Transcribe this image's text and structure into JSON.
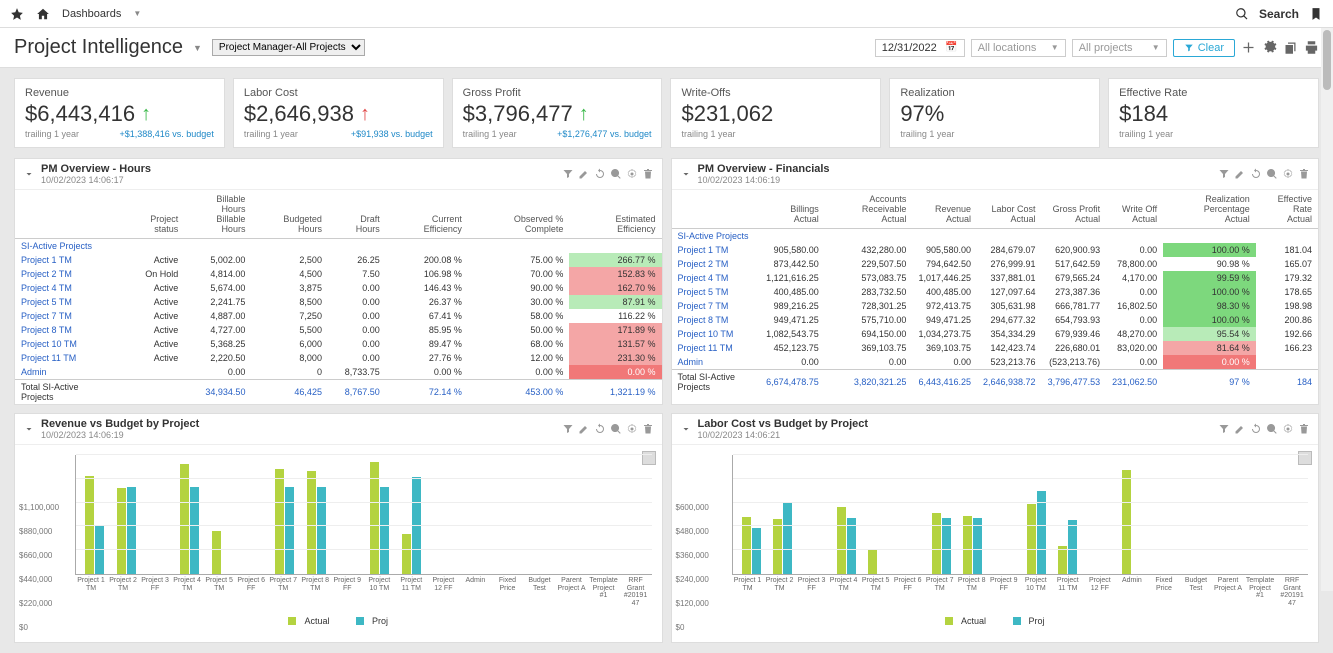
{
  "topbar": {
    "dashboards": "Dashboards",
    "search": "Search"
  },
  "header": {
    "title": "Project Intelligence",
    "dropdown": "Project Manager-All Projects",
    "date": "12/31/2022",
    "loc": "All locations",
    "proj": "All projects",
    "clear": "Clear"
  },
  "kpis": [
    {
      "label": "Revenue",
      "value": "$6,443,416",
      "arrow": "up",
      "sub": "trailing 1 year",
      "budget": "+$1,388,416 vs. budget"
    },
    {
      "label": "Labor Cost",
      "value": "$2,646,938",
      "arrow": "down-red",
      "sub": "trailing 1 year",
      "budget": "+$91,938 vs. budget"
    },
    {
      "label": "Gross Profit",
      "value": "$3,796,477",
      "arrow": "up",
      "sub": "trailing 1 year",
      "budget": "+$1,276,477 vs. budget"
    },
    {
      "label": "Write-Offs",
      "value": "$231,062",
      "arrow": "",
      "sub": "trailing 1 year",
      "budget": ""
    },
    {
      "label": "Realization",
      "value": "97%",
      "arrow": "",
      "sub": "trailing 1 year",
      "budget": ""
    },
    {
      "label": "Effective Rate",
      "value": "$184",
      "arrow": "",
      "sub": "trailing 1 year",
      "budget": ""
    }
  ],
  "hours": {
    "title": "PM Overview - Hours",
    "ts": "10/02/2023 14:06:17",
    "group": "SI-Active Projects",
    "cols": [
      "",
      "Project status",
      "Billable Hours\nBillable Hours",
      "Budgeted Hours",
      "Draft Hours",
      "Current Efficiency",
      "Observed % Complete",
      "Estimated Efficiency"
    ],
    "rows": [
      [
        "Project 1 TM",
        "Active",
        "5,002.00",
        "2,500",
        "26.25",
        "200.08 %",
        "75.00 %",
        "266.77 %",
        "lgreen"
      ],
      [
        "Project 2 TM",
        "On Hold",
        "4,814.00",
        "4,500",
        "7.50",
        "106.98 %",
        "70.00 %",
        "152.83 %",
        "red"
      ],
      [
        "Project 4 TM",
        "Active",
        "5,674.00",
        "3,875",
        "0.00",
        "146.43 %",
        "90.00 %",
        "162.70 %",
        "red"
      ],
      [
        "Project 5 TM",
        "Active",
        "2,241.75",
        "8,500",
        "0.00",
        "26.37 %",
        "30.00 %",
        "87.91 %",
        "lgreen"
      ],
      [
        "Project 7 TM",
        "Active",
        "4,887.00",
        "7,250",
        "0.00",
        "67.41 %",
        "58.00 %",
        "116.22 %",
        ""
      ],
      [
        "Project 8 TM",
        "Active",
        "4,727.00",
        "5,500",
        "0.00",
        "85.95 %",
        "50.00 %",
        "171.89 %",
        "red"
      ],
      [
        "Project 10 TM",
        "Active",
        "5,368.25",
        "6,000",
        "0.00",
        "89.47 %",
        "68.00 %",
        "131.57 %",
        "red"
      ],
      [
        "Project 11 TM",
        "Active",
        "2,220.50",
        "8,000",
        "0.00",
        "27.76 %",
        "12.00 %",
        "231.30 %",
        "red"
      ],
      [
        "Admin",
        "",
        "0.00",
        "0",
        "8,733.75",
        "0.00 %",
        "0.00 %",
        "0.00 %",
        "dred"
      ]
    ],
    "total": [
      "Total SI-Active Projects",
      "",
      "34,934.50",
      "46,425",
      "8,767.50",
      "72.14 %",
      "453.00 %",
      "1,321.19 %"
    ]
  },
  "fin": {
    "title": "PM Overview - Financials",
    "ts": "10/02/2023 14:06:19",
    "group": "SI-Active Projects",
    "cols": [
      "",
      "Billings\nActual",
      "Accounts Receivable\nActual",
      "Revenue\nActual",
      "Labor Cost\nActual",
      "Gross Profit\nActual",
      "Write Off\nActual",
      "Realization Percentage\nActual",
      "Effective Rate\nActual"
    ],
    "rows": [
      [
        "Project 1 TM",
        "905,580.00",
        "432,280.00",
        "905,580.00",
        "284,679.07",
        "620,900.93",
        "0.00",
        "100.00 %",
        "181.04",
        "green"
      ],
      [
        "Project 2 TM",
        "873,442.50",
        "229,507.50",
        "794,642.50",
        "276,999.91",
        "517,642.59",
        "78,800.00",
        "90.98 %",
        "165.07",
        ""
      ],
      [
        "Project 4 TM",
        "1,121,616.25",
        "573,083.75",
        "1,017,446.25",
        "337,881.01",
        "679,565.24",
        "4,170.00",
        "99.59 %",
        "179.32",
        "green"
      ],
      [
        "Project 5 TM",
        "400,485.00",
        "283,732.50",
        "400,485.00",
        "127,097.64",
        "273,387.36",
        "0.00",
        "100.00 %",
        "178.65",
        "green"
      ],
      [
        "Project 7 TM",
        "989,216.25",
        "728,301.25",
        "972,413.75",
        "305,631.98",
        "666,781.77",
        "16,802.50",
        "98.30 %",
        "198.98",
        "green"
      ],
      [
        "Project 8 TM",
        "949,471.25",
        "575,710.00",
        "949,471.25",
        "294,677.32",
        "654,793.93",
        "0.00",
        "100.00 %",
        "200.86",
        "green"
      ],
      [
        "Project 10 TM",
        "1,082,543.75",
        "694,150.00",
        "1,034,273.75",
        "354,334.29",
        "679,939.46",
        "48,270.00",
        "95.54 %",
        "192.66",
        "lgreen"
      ],
      [
        "Project 11 TM",
        "452,123.75",
        "369,103.75",
        "369,103.75",
        "142,423.74",
        "226,680.01",
        "83,020.00",
        "81.64 %",
        "166.23",
        "red"
      ],
      [
        "Admin",
        "0.00",
        "0.00",
        "0.00",
        "523,213.76",
        "(523,213.76)",
        "0.00",
        "0.00 %",
        "",
        "dred"
      ]
    ],
    "total": [
      "Total SI-Active Projects",
      "6,674,478.75",
      "3,820,321.25",
      "6,443,416.25",
      "2,646,938.72",
      "3,796,477.53",
      "231,062.50",
      "97 %",
      "184"
    ]
  },
  "chart_data": [
    {
      "type": "bar",
      "title": "Revenue vs Budget by Project",
      "ts": "10/02/2023 14:06:19",
      "ylabel": "",
      "ylim": [
        0,
        1100000
      ],
      "yticks": [
        "$0",
        "$220,000",
        "$440,000",
        "$660,000",
        "$880,000",
        "$1,100,000"
      ],
      "categories": [
        "Project 1 TM",
        "Project 2 TM",
        "Project 3 FF",
        "Project 4 TM",
        "Project 5 TM",
        "Project 6 FF",
        "Project 7 TM",
        "Project 8 TM",
        "Project 9 FF",
        "Project 10 TM",
        "Project 11 TM",
        "Project 12 FF",
        "Admin",
        "Fixed Price",
        "Budget Test",
        "Parent Project A",
        "Template Project #1",
        "RRF Grant #20191 47"
      ],
      "series": [
        {
          "name": "Actual",
          "values": [
            905000,
            795000,
            0,
            1017000,
            400000,
            0,
            972000,
            949000,
            0,
            1034000,
            369000,
            0,
            0,
            0,
            0,
            0,
            0,
            0
          ]
        },
        {
          "name": "Proj",
          "values": [
            450000,
            800000,
            0,
            800000,
            0,
            0,
            800000,
            800000,
            0,
            800000,
            900000,
            0,
            0,
            0,
            0,
            0,
            0,
            0
          ]
        }
      ],
      "legend": [
        "Actual",
        "Proj"
      ]
    },
    {
      "type": "bar",
      "title": "Labor Cost vs Budget by Project",
      "ts": "10/02/2023 14:06:21",
      "ylabel": "",
      "ylim": [
        0,
        600000
      ],
      "yticks": [
        "$0",
        "$120,000",
        "$240,000",
        "$360,000",
        "$480,000",
        "$600,000"
      ],
      "categories": [
        "Project 1 TM",
        "Project 2 TM",
        "Project 3 FF",
        "Project 4 TM",
        "Project 5 TM",
        "Project 6 FF",
        "Project 7 TM",
        "Project 8 TM",
        "Project 9 FF",
        "Project 10 TM",
        "Project 11 TM",
        "Project 12 FF",
        "Admin",
        "Fixed Price",
        "Budget Test",
        "Parent Project A",
        "Template Project #1",
        "RRF Grant #20191 47"
      ],
      "series": [
        {
          "name": "Actual",
          "values": [
            285000,
            277000,
            0,
            338000,
            127000,
            0,
            306000,
            295000,
            0,
            354000,
            142000,
            0,
            523000,
            0,
            0,
            0,
            0,
            0
          ]
        },
        {
          "name": "Proj",
          "values": [
            230000,
            360000,
            0,
            280000,
            0,
            0,
            280000,
            280000,
            0,
            420000,
            270000,
            0,
            0,
            0,
            0,
            0,
            0,
            0
          ]
        }
      ],
      "legend": [
        "Actual",
        "Proj"
      ]
    }
  ]
}
